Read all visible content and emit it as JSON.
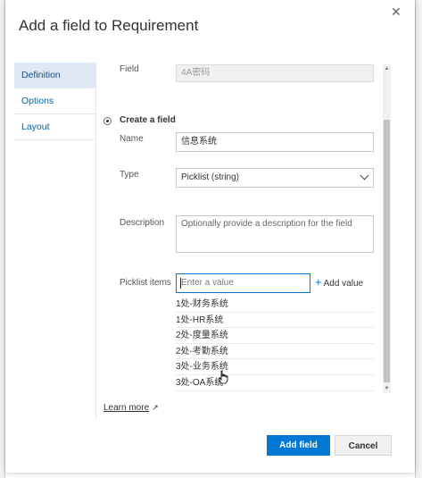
{
  "dialog": {
    "title": "Add a field to Requirement",
    "close_glyph": "✕"
  },
  "nav": {
    "items": [
      {
        "label": "Definition",
        "active": true
      },
      {
        "label": "Options",
        "active": false
      },
      {
        "label": "Layout",
        "active": false
      }
    ]
  },
  "form": {
    "field_label": "Field",
    "field_value": "4A密码",
    "create_label": "Create a field",
    "name_label": "Name",
    "name_value": "信息系统",
    "type_label": "Type",
    "type_value": "Picklist (string)",
    "description_label": "Description",
    "description_placeholder": "Optionally provide a description for the field",
    "picklist_label": "Picklist items",
    "picklist_placeholder": "Enter a value",
    "add_value_label": "Add value",
    "picklist_items": [
      "1处-财务系统",
      "1处-HR系统",
      "2处-度量系统",
      "2处-考勤系统",
      "3处-业务系统",
      "3处-OA系统"
    ]
  },
  "footer": {
    "learn_more": "Learn more",
    "add_field": "Add field",
    "cancel": "Cancel"
  },
  "colors": {
    "accent": "#0078d4",
    "nav_active_bg": "#dfe8f5"
  }
}
